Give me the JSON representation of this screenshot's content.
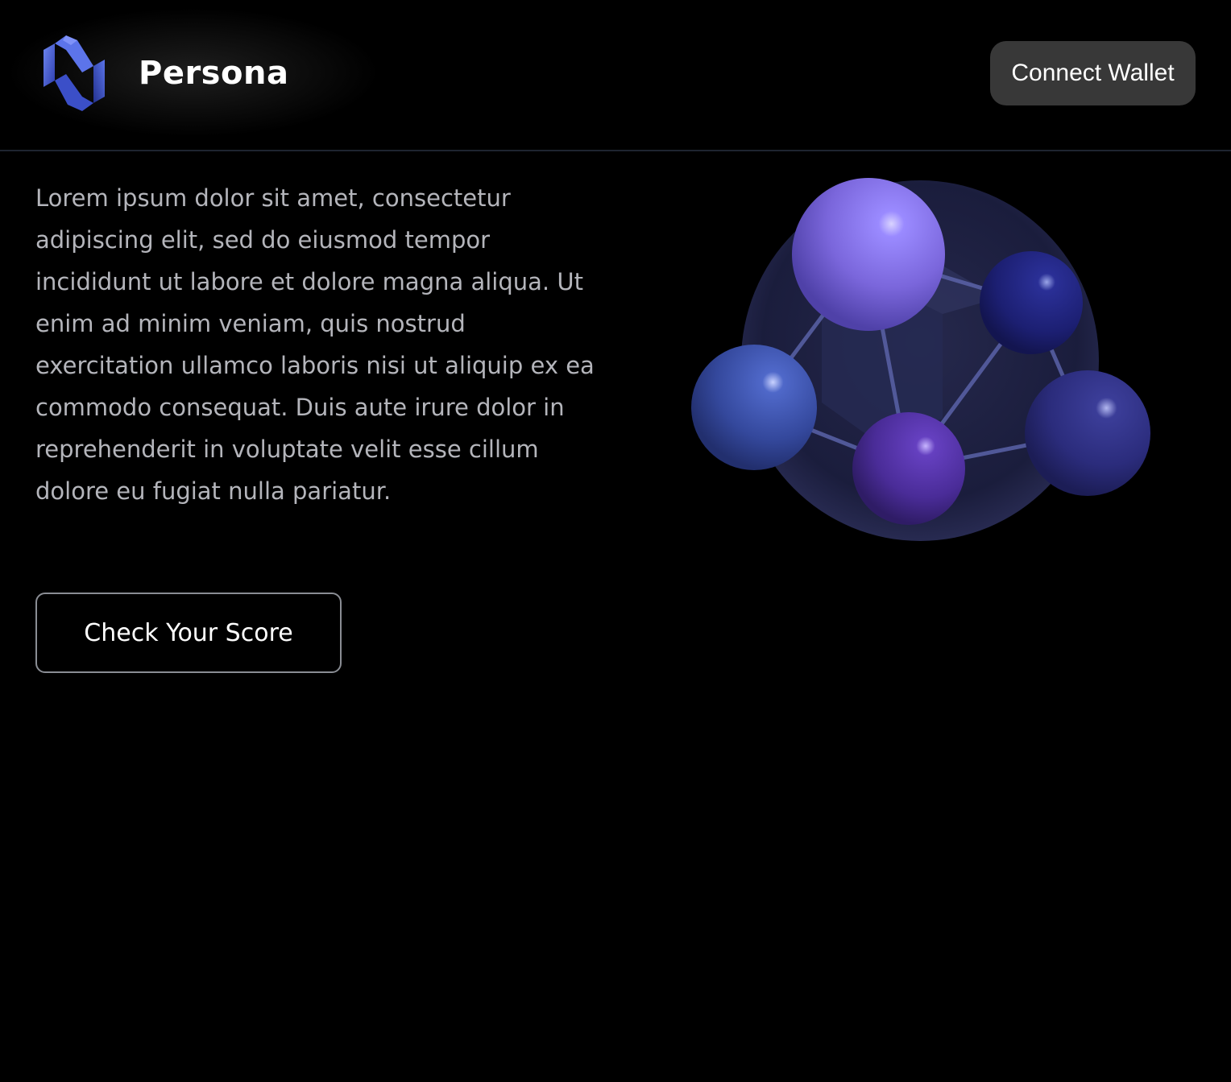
{
  "header": {
    "brand": "Persona",
    "logo_icon": "persona-logo-icon",
    "connect_label": "Connect Wallet"
  },
  "hero": {
    "description": "Lorem ipsum dolor sit amet, consectetur adipiscing elit, sed do eiusmod tempor incididunt ut labore et dolore magna aliqua. Ut enim ad minim veniam, quis nostrud exercitation ullamco laboris nisi ut aliquip ex ea commodo consequat. Duis aute irure dolor in reprehenderit in voluptate velit esse cillum dolore eu fugiat nulla pariatur.",
    "cta_label": "Check Your Score",
    "illustration_icon": "molecule-illustration"
  },
  "colors": {
    "background": "#000000",
    "accent": "#4a5bd6",
    "button_bg": "#383838",
    "body_text": "#b4b5bb"
  }
}
